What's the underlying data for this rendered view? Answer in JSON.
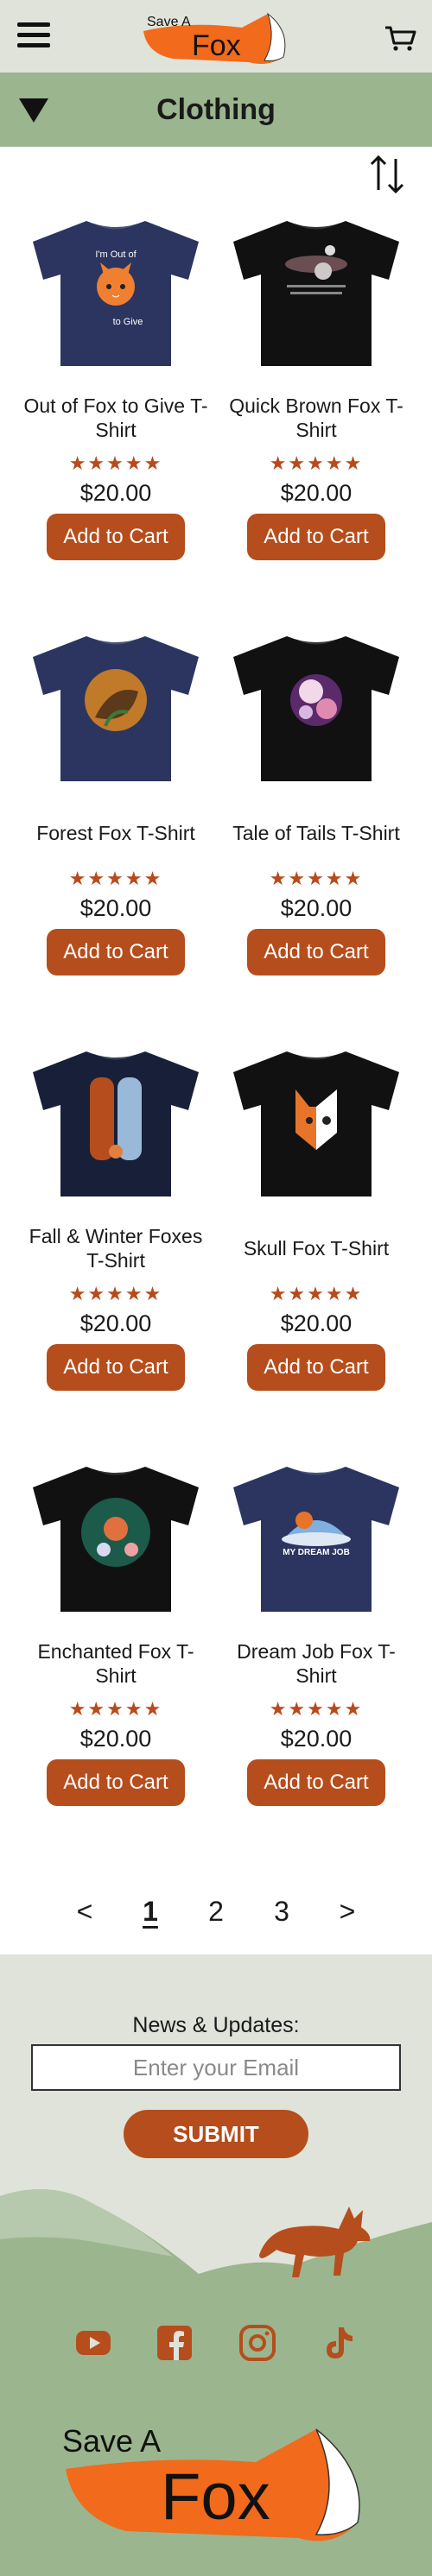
{
  "header": {
    "logo_text_top": "Save A",
    "logo_text_bottom": "Fox"
  },
  "category": {
    "title": "Clothing"
  },
  "products": [
    {
      "name": "Out of Fox to Give T-Shirt",
      "stars": "★★★★★",
      "price": "$20.00",
      "button": "Add to Cart",
      "shirt_color": "#2b3560",
      "art_text_1": "I'm Out of",
      "art_text_2": "to Give"
    },
    {
      "name": "Quick Brown Fox T-Shirt",
      "stars": "★★★★★",
      "price": "$20.00",
      "button": "Add to Cart",
      "shirt_color": "#111111"
    },
    {
      "name": "Forest Fox T-Shirt",
      "stars": "★★★★★",
      "price": "$20.00",
      "button": "Add to Cart",
      "shirt_color": "#2b3560"
    },
    {
      "name": "Tale of Tails T-Shirt",
      "stars": "★★★★★",
      "price": "$20.00",
      "button": "Add to Cart",
      "shirt_color": "#111111"
    },
    {
      "name": "Fall & Winter Foxes T-Shirt",
      "stars": "★★★★★",
      "price": "$20.00",
      "button": "Add to Cart",
      "shirt_color": "#172038"
    },
    {
      "name": "Skull Fox T-Shirt",
      "stars": "★★★★★",
      "price": "$20.00",
      "button": "Add to Cart",
      "shirt_color": "#111111"
    },
    {
      "name": "Enchanted Fox T-Shirt",
      "stars": "★★★★★",
      "price": "$20.00",
      "button": "Add to Cart",
      "shirt_color": "#111111"
    },
    {
      "name": "Dream Job Fox T-Shirt",
      "stars": "★★★★★",
      "price": "$20.00",
      "button": "Add to Cart",
      "shirt_color": "#2b3560",
      "art_text_1": "MY DREAM JOB"
    }
  ],
  "pagination": {
    "prev": "<",
    "pages": [
      "1",
      "2",
      "3"
    ],
    "current": "1",
    "next": ">"
  },
  "footer": {
    "news_title": "News & Updates:",
    "email_placeholder": "Enter your Email",
    "submit_label": "SUBMIT",
    "logo_text_top": "Save A",
    "logo_text_bottom": "Fox"
  },
  "colors": {
    "accent": "#b64d1c",
    "header_bg": "#dfe3da",
    "category_bg": "#9bb58f",
    "hill_green": "#9bb58f",
    "logo_orange": "#f26a1b"
  },
  "icons": [
    "hamburger-icon",
    "cart-icon",
    "dropdown-triangle-icon",
    "sort-icon",
    "youtube-icon",
    "facebook-icon",
    "instagram-icon",
    "tiktok-icon"
  ]
}
